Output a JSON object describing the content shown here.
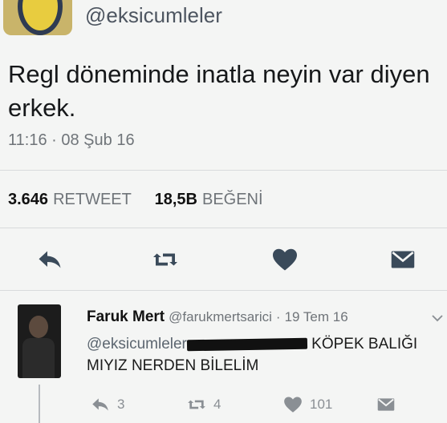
{
  "tweet": {
    "handle": "@eksicumleler",
    "text": "Regl döneminde inatla neyin var diyen erkek.",
    "time": "11:16",
    "dot": "·",
    "date": "08 Şub 16",
    "stats": {
      "retweets_value": "3.646",
      "retweets_label": "RETWEET",
      "likes_value": "18,5B",
      "likes_label": "BEĞENİ"
    },
    "actions": {
      "reply": "reply-icon",
      "retweet": "retweet-icon",
      "like": "heart-icon",
      "message": "envelope-icon"
    }
  },
  "reply": {
    "name": "Faruk Mert",
    "handle": "@farukmertsarici",
    "dot": "·",
    "date": "19 Tem 16",
    "mention": "@eksicumleler",
    "text_after_redaction": " KÖPEK BALIĞI MIYIZ NERDEN BİLELİM",
    "reply_count": "3",
    "retweet_count": "4",
    "like_count": "101"
  },
  "colors": {
    "background": "#f4f5f4",
    "text": "#16181a",
    "secondary": "#6f7479",
    "icon": "#3a4a5a",
    "divider": "#d8dadc"
  }
}
